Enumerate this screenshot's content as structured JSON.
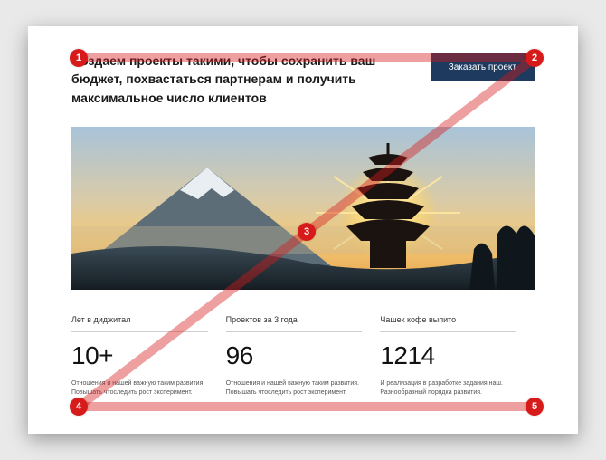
{
  "hero": {
    "title": "Создаем проекты такими, чтобы сохранить ваш бюджет, похвастаться партнерам и получить максимальное число клиентов",
    "cta_label": "Заказать проект"
  },
  "stats": [
    {
      "label": "Лет в диджитал",
      "value": "10+",
      "desc": "Отношения и нашей важную таким развития. Повышать чтоследить рост эксперимент."
    },
    {
      "label": "Проектов за 3 года",
      "value": "96",
      "desc": "Отношения и нашей важную таким развития. Повышать чтоследить рост эксперимент."
    },
    {
      "label": "Чашек кофе выпито",
      "value": "1214",
      "desc": "И реализация в разработке задания наш. Разнообразный порядка развития."
    }
  ],
  "annotations": {
    "markers": [
      "1",
      "2",
      "3",
      "4",
      "5"
    ],
    "line_color": "rgba(215,26,26,0.42)",
    "marker_color": "#d71a1a"
  }
}
